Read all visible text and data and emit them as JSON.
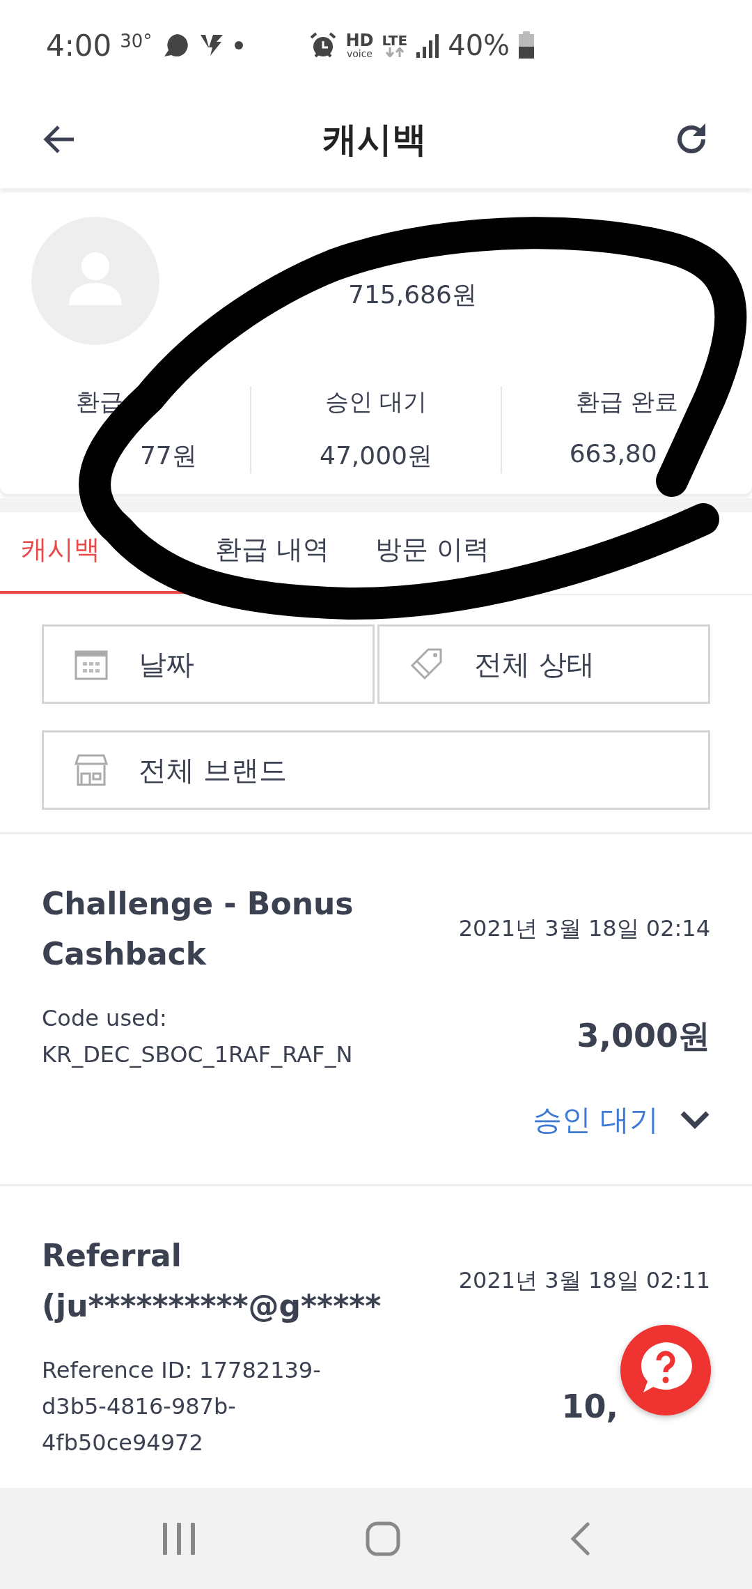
{
  "status_bar": {
    "time": "4:00",
    "temperature": "30°",
    "hd": "HD",
    "voice": "voice",
    "network": "LTE",
    "battery": "40%"
  },
  "app_bar": {
    "title": "캐시백"
  },
  "profile": {
    "balance": "715,686원",
    "stats": [
      {
        "label": "환급",
        "value": "77원"
      },
      {
        "label": "승인 대기",
        "value": "47,000원"
      },
      {
        "label": "환급 완료",
        "value": "663,80"
      }
    ]
  },
  "tabs": [
    {
      "label": "캐시백",
      "selected": true
    },
    {
      "label": "환급 내역",
      "selected": false
    },
    {
      "label": "방문 이력",
      "selected": false
    }
  ],
  "filters": [
    {
      "kind": "date",
      "label": "날짜"
    },
    {
      "kind": "status",
      "label": "전체 상태"
    },
    {
      "kind": "brand",
      "label": "전체 브랜드"
    }
  ],
  "transactions": [
    {
      "title_lines": [
        "Challenge - Bonus",
        "Cashback"
      ],
      "date": "2021년 3월 18일 02:14",
      "detail_lines": [
        "Code used:",
        "KR_DEC_SBOC_1RAF_RAF_N"
      ],
      "amount": "3,000원",
      "status": "승인 대기"
    },
    {
      "title_lines": [
        "Referral",
        "(ju**********@g*****"
      ],
      "date": "2021년 3월 18일 02:11",
      "detail_lines": [
        "Reference ID: 17782139-",
        "d3b5-4816-987b-",
        "4fb50ce94972"
      ],
      "amount": "10,"
    }
  ]
}
